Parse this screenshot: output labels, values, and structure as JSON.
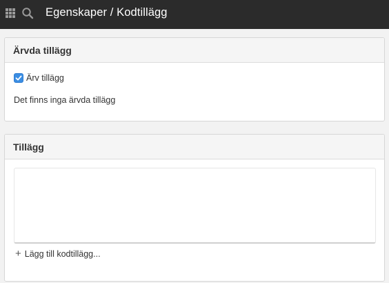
{
  "header": {
    "title": "Egenskaper / Kodtillägg",
    "icons": [
      "grid-icon",
      "search-icon"
    ]
  },
  "inherited_panel": {
    "title": "Ärvda tillägg",
    "checkbox_label": "Ärv tillägg",
    "checkbox_checked": true,
    "empty_text": "Det finns inga ärvda tillägg"
  },
  "addons_panel": {
    "title": "Tillägg",
    "items": [],
    "add_label": "Lägg till kodtillägg..."
  },
  "colors": {
    "topbar": "#2b2b2b",
    "accent": "#3b8ee3"
  }
}
